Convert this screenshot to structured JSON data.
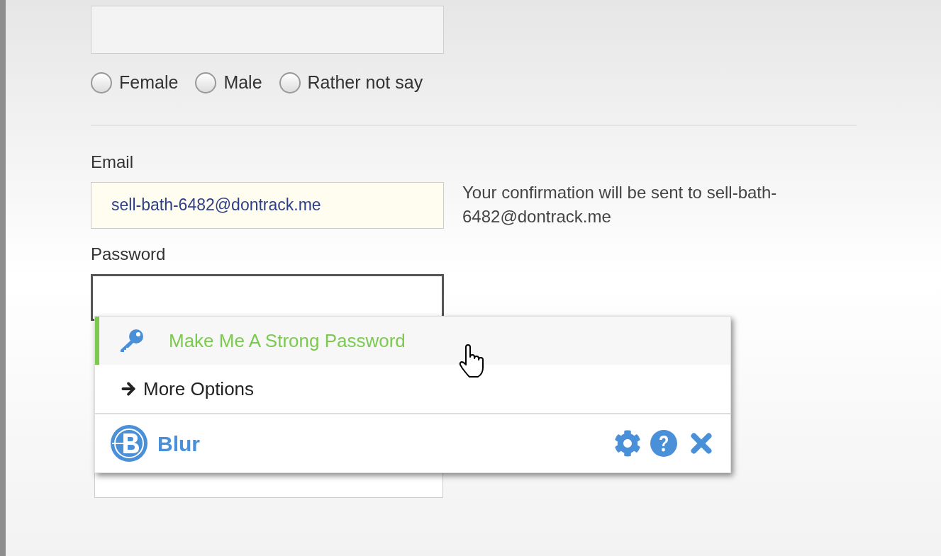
{
  "gender_options": [
    {
      "label": "Female",
      "selected": false
    },
    {
      "label": "Male",
      "selected": false
    },
    {
      "label": "Rather not say",
      "selected": false
    }
  ],
  "email": {
    "label": "Email",
    "value": "sell-bath-6482@dontrack.me",
    "autofilled": true
  },
  "email_note": "Your confirmation will be sent to sell-bath-6482@dontrack.me",
  "password": {
    "label": "Password",
    "focused": true
  },
  "popup": {
    "items": [
      {
        "kind": "generate",
        "label": "Make Me A Strong Password",
        "selected": true
      },
      {
        "kind": "more",
        "label": "More Options",
        "selected": false
      }
    ],
    "brand": "Blur"
  }
}
